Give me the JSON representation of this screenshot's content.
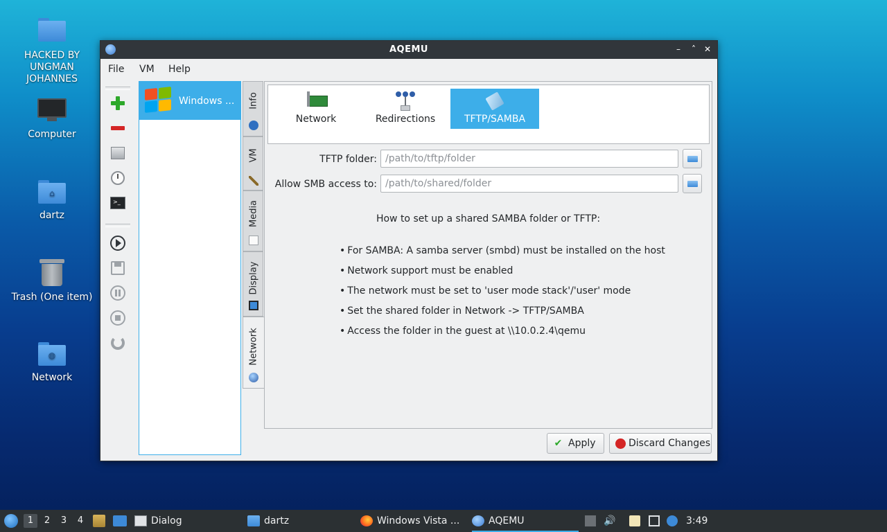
{
  "desktop": {
    "icons": [
      {
        "label": "HACKED BY UNGMAN JOHANNES",
        "icon": "folder-icon"
      },
      {
        "label": "Computer",
        "icon": "computer-icon"
      },
      {
        "label": "dartz",
        "icon": "home-folder-icon"
      },
      {
        "label": "Trash (One item)",
        "icon": "trash-icon"
      },
      {
        "label": "Network",
        "icon": "network-folder-icon"
      }
    ]
  },
  "window": {
    "title": "AQEMU",
    "controls": {
      "minimize": "–",
      "maximize": "˄",
      "close": "✕"
    }
  },
  "menu": {
    "file": "File",
    "vm": "VM",
    "help": "Help"
  },
  "toolbar": {
    "buttons": [
      "add-vm-icon",
      "delete-vm-icon",
      "drive-icon",
      "clock-icon",
      "terminal-icon",
      "play-icon",
      "save-icon",
      "pause-icon",
      "stop-icon",
      "reset-icon"
    ]
  },
  "vm_list": {
    "items": [
      {
        "label": "Windows ...",
        "selected": true
      }
    ]
  },
  "side_tabs": [
    {
      "label": "Info"
    },
    {
      "label": "VM"
    },
    {
      "label": "Media"
    },
    {
      "label": "Display"
    },
    {
      "label": "Network",
      "active": true
    }
  ],
  "network_tabs": [
    {
      "label": "Network"
    },
    {
      "label": "Redirections"
    },
    {
      "label": "TFTP/SAMBA",
      "active": true
    }
  ],
  "form": {
    "tftp_label": "TFTP folder:",
    "tftp_placeholder": "/path/to/tftp/folder",
    "tftp_value": "",
    "smb_label": "Allow SMB access to:",
    "smb_placeholder": "/path/to/shared/folder",
    "smb_value": ""
  },
  "help": {
    "title": "How to set up a shared SAMBA folder or TFTP:",
    "items": [
      "For SAMBA: A samba server (smbd) must be installed on the host",
      "Network support must be enabled",
      "The network must be set to 'user mode stack'/'user' mode",
      "Set the shared folder in Network -> TFTP/SAMBA",
      "Access the folder in the guest at \\\\10.0.2.4\\qemu"
    ]
  },
  "actions": {
    "apply": "Apply",
    "discard": "Discard Changes"
  },
  "taskbar": {
    "workspaces": [
      "1",
      "2",
      "3",
      "4"
    ],
    "active_workspace": "1",
    "tasks": [
      {
        "label": "Dialog",
        "icon": "window-icon"
      },
      {
        "label": "dartz",
        "icon": "folder-icon"
      },
      {
        "label": "Windows Vista ...",
        "icon": "firefox-icon"
      },
      {
        "label": "AQEMU",
        "icon": "aqemu-icon",
        "active": true
      }
    ],
    "clock": "3:49"
  },
  "colors": {
    "accent": "#3daee9",
    "titlebar": "#31363b",
    "taskbar": "#2b3033"
  }
}
